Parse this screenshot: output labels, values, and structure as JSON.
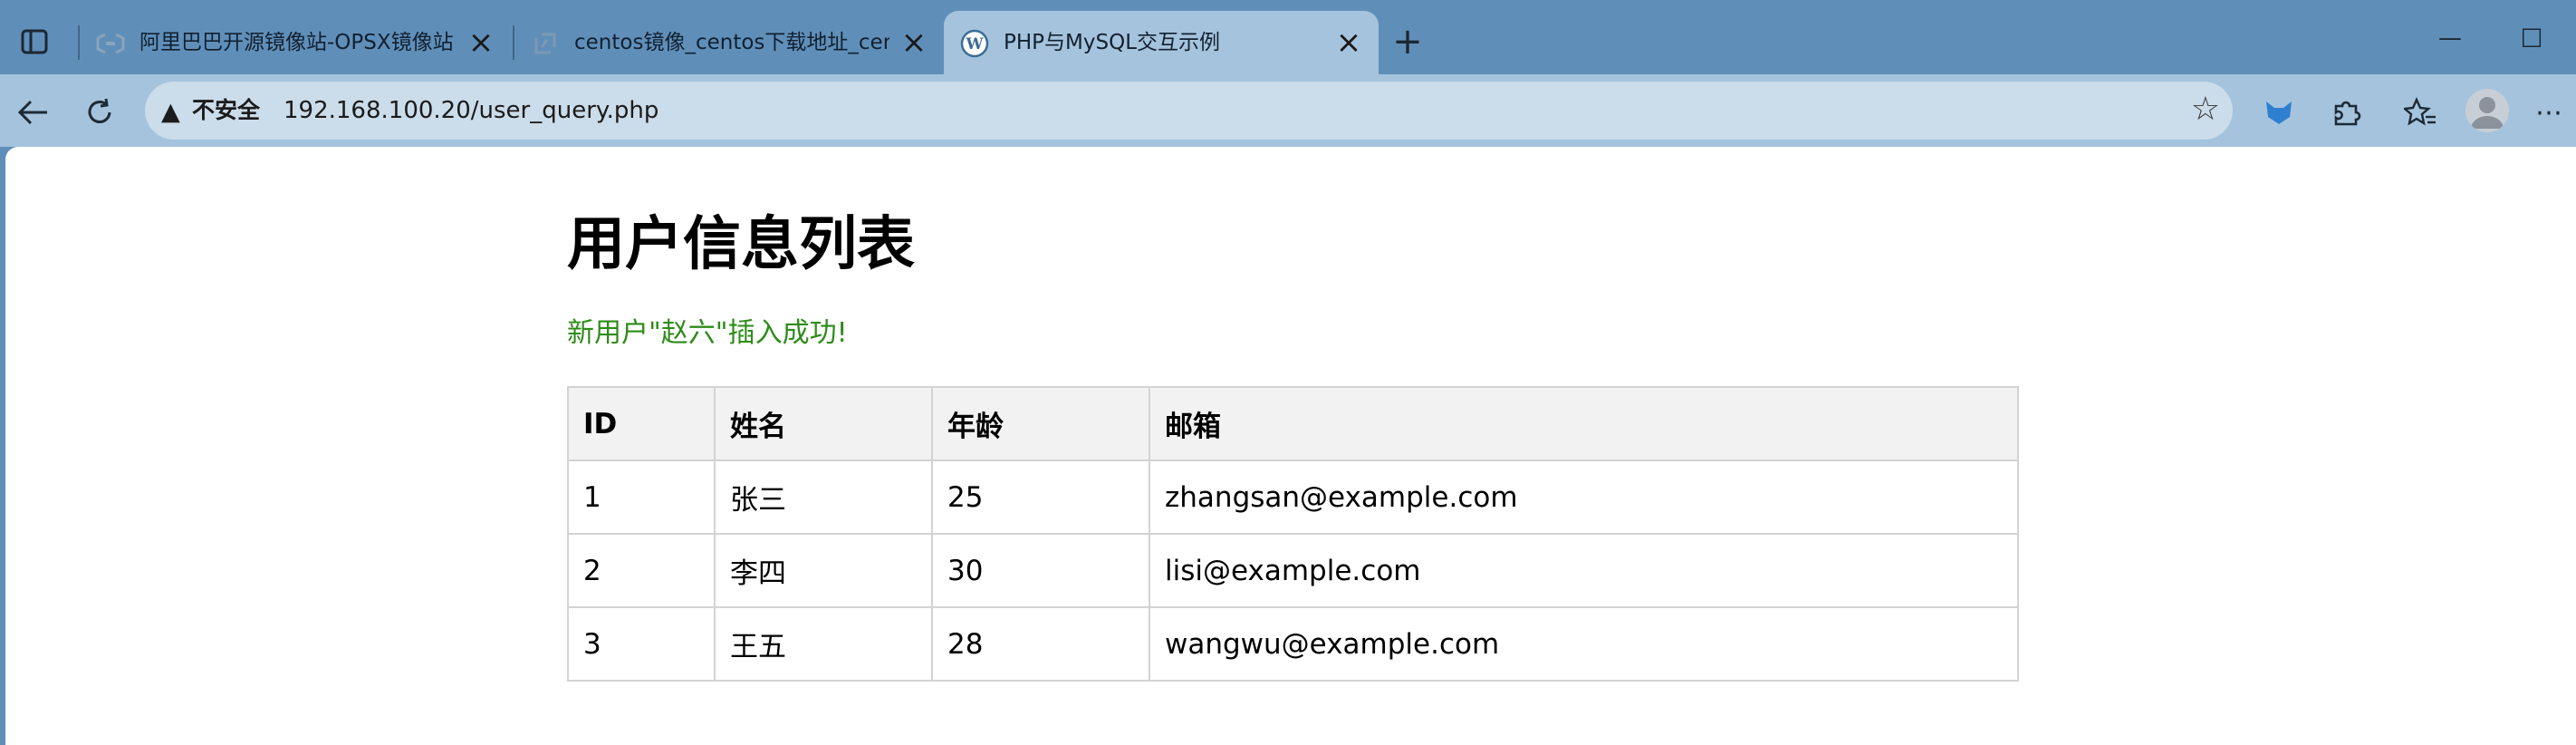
{
  "tabs": [
    {
      "title": "阿里巴巴开源镜像站-OPSX镜像站",
      "close": "×"
    },
    {
      "title": "centos镜像_centos下载地址_centos",
      "close": "×"
    },
    {
      "title": "PHP与MySQL交互示例",
      "close": "×"
    }
  ],
  "new_tab": "+",
  "window_controls": {
    "minimize": "—",
    "maximize": "☐"
  },
  "address_bar": {
    "security_label": "不安全",
    "url": "192.168.100.20/user_query.php"
  },
  "icons": {
    "back": "back-arrow-icon",
    "reload": "reload-icon",
    "warning": "warning-triangle-icon",
    "star": "favorite-star-icon",
    "extension_fox": "extension-fox-icon",
    "extensions": "puzzle-icon",
    "favorites": "favorites-icon",
    "profile": "profile-avatar-icon",
    "menu": "more-menu-icon"
  },
  "colors": {
    "tabbar_bg": "#5f8fb9",
    "active_tab_bg": "#a5c3dd",
    "success_text": "#2e8b1a",
    "table_header_bg": "#f2f2f2"
  },
  "page": {
    "heading": "用户信息列表",
    "success_message": "新用户\"赵六\"插入成功!",
    "table": {
      "headers": [
        "ID",
        "姓名",
        "年龄",
        "邮箱"
      ],
      "rows": [
        [
          "1",
          "张三",
          "25",
          "zhangsan@example.com"
        ],
        [
          "2",
          "李四",
          "30",
          "lisi@example.com"
        ],
        [
          "3",
          "王五",
          "28",
          "wangwu@example.com"
        ]
      ]
    }
  }
}
